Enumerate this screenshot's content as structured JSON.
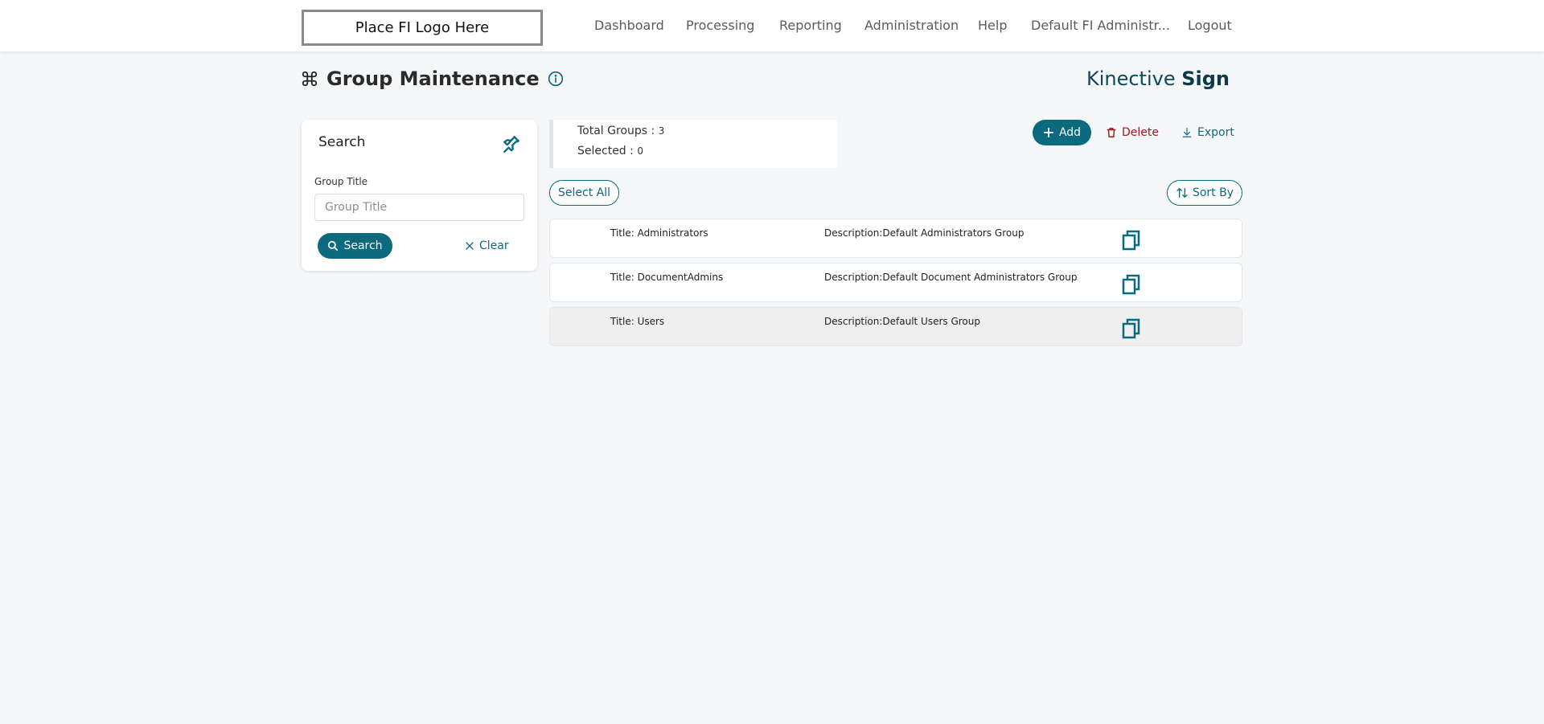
{
  "header": {
    "logo_text": "Place FI Logo Here",
    "nav": [
      {
        "label": "Dashboard"
      },
      {
        "label": "Processing"
      },
      {
        "label": "Reporting"
      },
      {
        "label": "Administration"
      },
      {
        "label": "Help"
      },
      {
        "label": "Default FI Administr..."
      },
      {
        "label": "Logout"
      }
    ]
  },
  "page": {
    "title": "Group Maintenance",
    "brand_light": "Kinective ",
    "brand_bold": "Sign"
  },
  "search": {
    "heading": "Search",
    "field_label": "Group Title",
    "field_placeholder": "Group Title",
    "field_value": "",
    "search_label": "Search",
    "clear_label": "Clear"
  },
  "totals": {
    "total_label": "Total Groups : ",
    "total_value": "3",
    "selected_label": "Selected : ",
    "selected_value": "0"
  },
  "actions": {
    "add_label": "Add",
    "delete_label": "Delete",
    "export_label": "Export",
    "select_all_label": "Select All",
    "sort_by_label": "Sort By"
  },
  "groups": [
    {
      "title": "Title: Administrators",
      "description": "Description:Default Administrators Group"
    },
    {
      "title": "Title: DocumentAdmins",
      "description": "Description:Default Document Administrators Group"
    },
    {
      "title": "Title: Users",
      "description": "Description:Default Users Group"
    }
  ],
  "colors": {
    "accent": "#0b6a7d",
    "delete": "#a4161a",
    "background": "#f5f7f9"
  },
  "icons": [
    "command-icon",
    "info-icon",
    "pin-icon",
    "search-icon",
    "close-icon",
    "plus-icon",
    "trash-icon",
    "download-icon",
    "sort-icon",
    "copy-icon"
  ]
}
